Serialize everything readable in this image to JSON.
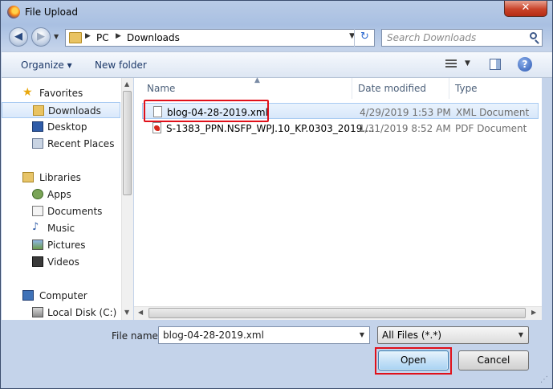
{
  "window": {
    "title": "File Upload",
    "close_label": "✕"
  },
  "nav": {
    "back_label": "◀",
    "forward_label": "▶",
    "breadcrumbs": [
      "PC",
      "Downloads"
    ],
    "refresh_label": "↻"
  },
  "search": {
    "placeholder": "Search Downloads"
  },
  "toolbar": {
    "organize": "Organize ▾",
    "new_folder": "New folder"
  },
  "sidebar": {
    "favorites": [
      {
        "label": "Favorites",
        "icon": "star-icon"
      },
      {
        "label": "Downloads",
        "icon": "downloads-folder-icon",
        "selected": true
      },
      {
        "label": "Desktop",
        "icon": "desktop-icon"
      },
      {
        "label": "Recent Places",
        "icon": "recent-places-icon"
      }
    ],
    "libraries": [
      {
        "label": "Libraries",
        "icon": "libraries-icon"
      },
      {
        "label": "Apps",
        "icon": "apps-icon"
      },
      {
        "label": "Documents",
        "icon": "documents-icon"
      },
      {
        "label": "Music",
        "icon": "music-icon"
      },
      {
        "label": "Pictures",
        "icon": "pictures-icon"
      },
      {
        "label": "Videos",
        "icon": "videos-icon"
      }
    ],
    "computer": [
      {
        "label": "Computer",
        "icon": "computer-icon"
      },
      {
        "label": "Local Disk (C:)",
        "icon": "local-disk-icon"
      }
    ]
  },
  "columns": {
    "name": "Name",
    "date_modified": "Date modified",
    "type": "Type"
  },
  "files": [
    {
      "name": "blog-04-28-2019.xml",
      "date": "4/29/2019 1:53 PM",
      "type": "XML Document",
      "icon": "xml-file-icon",
      "selected": true
    },
    {
      "name": "S-1383_PPN.NSFP_WPJ.10_KP.0303_2019....",
      "date": "1/31/2019 8:52 AM",
      "type": "PDF Document",
      "icon": "pdf-file-icon"
    }
  ],
  "footer": {
    "file_name_label": "File name:",
    "file_name_value": "blog-04-28-2019.xml",
    "filter_value": "All Files (*.*)",
    "open_label": "Open",
    "cancel_label": "Cancel"
  },
  "colors": {
    "highlight": "#e0101a",
    "selection": "#d9e8fb"
  }
}
